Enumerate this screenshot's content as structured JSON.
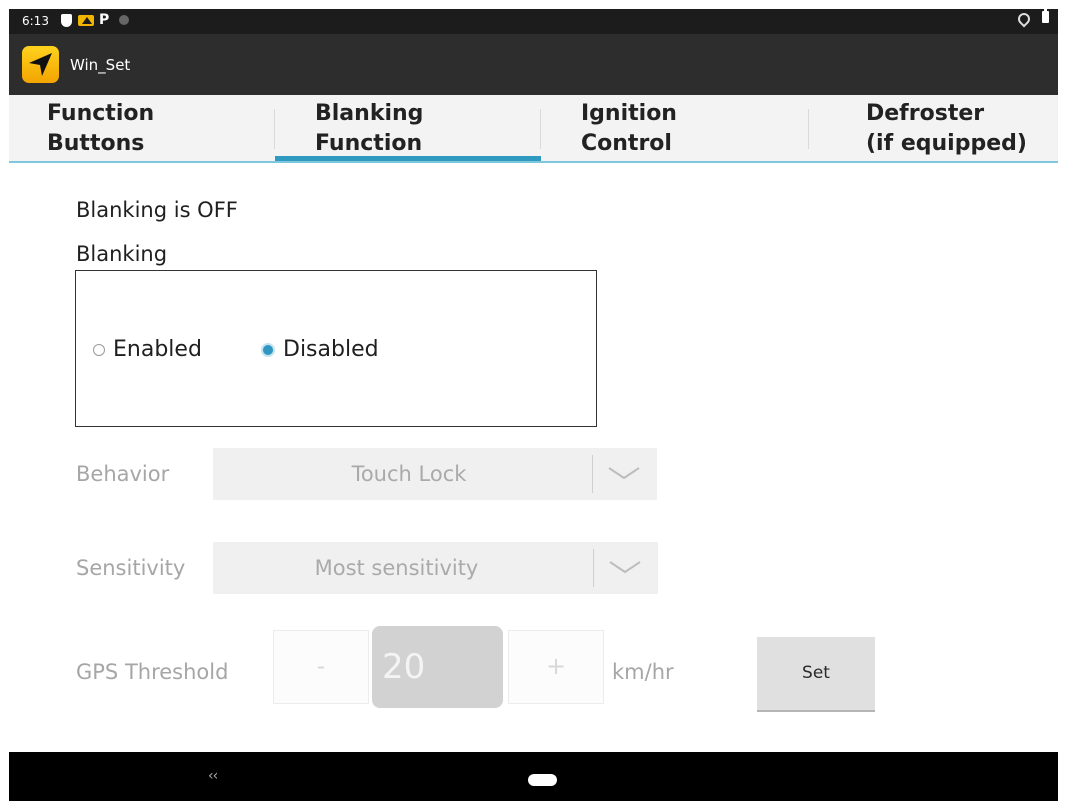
{
  "status_bar": {
    "time": "6:13",
    "icons": [
      "shield-icon",
      "camera-alert-icon",
      "parking-icon",
      "signal-icon",
      "location-icon",
      "battery-icon"
    ]
  },
  "app_bar": {
    "title": "Win_Set",
    "icon": "navigation-arrow-icon",
    "icon_color": "#f7b500"
  },
  "tabs": [
    {
      "line1": "Function",
      "line2": "Buttons",
      "active": false
    },
    {
      "line1": "Blanking",
      "line2": "Function",
      "active": true
    },
    {
      "line1": "Ignition",
      "line2": "Control",
      "active": false
    },
    {
      "line1": "Defroster",
      "line2": "(if equipped)",
      "active": false
    }
  ],
  "blanking": {
    "status_text": "Blanking is OFF",
    "section_label": "Blanking",
    "options": [
      {
        "label": "Enabled",
        "selected": false
      },
      {
        "label": "Disabled",
        "selected": true
      }
    ]
  },
  "behavior": {
    "label": "Behavior",
    "selected": "Touch Lock"
  },
  "sensitivity": {
    "label": "Sensitivity",
    "selected": "Most sensitivity"
  },
  "gps_threshold": {
    "label": "GPS Threshold",
    "minus_label": "-",
    "value": "20",
    "plus_label": "+",
    "unit": "km/hr",
    "set_label": "Set"
  },
  "nav_bar": {
    "back_label": "‹‹"
  },
  "colors": {
    "accent": "#2e9ac0",
    "tab_underline": "#7fc7df",
    "disabled_text": "#a6a6a6",
    "app_bar": "#2d2d2d"
  }
}
